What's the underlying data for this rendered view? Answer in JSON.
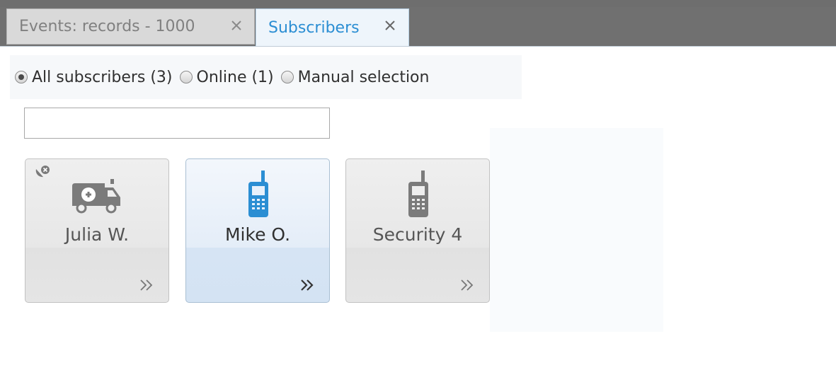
{
  "tabs": [
    {
      "label": "Events: records - 1000",
      "active": false
    },
    {
      "label": "Subscribers",
      "active": true
    }
  ],
  "filter": {
    "options": [
      {
        "label": "All subscribers (3)",
        "checked": true
      },
      {
        "label": "Online (1)",
        "checked": false
      },
      {
        "label": "Manual selection",
        "checked": false
      }
    ]
  },
  "search": {
    "value": "",
    "placeholder": ""
  },
  "subscribers": [
    {
      "name": "Julia W.",
      "icon": "ambulance-icon",
      "status_icon": "gps-off-icon",
      "selected": false
    },
    {
      "name": "Mike O.",
      "icon": "mobile-phone-icon",
      "selected": true
    },
    {
      "name": "Security 4",
      "icon": "mobile-phone-icon",
      "selected": false
    }
  ],
  "colors": {
    "accent": "#2b8ed3",
    "tab_bar": "#707070",
    "card_active": "#dde8f5",
    "card_inactive": "#e8e8e8"
  }
}
